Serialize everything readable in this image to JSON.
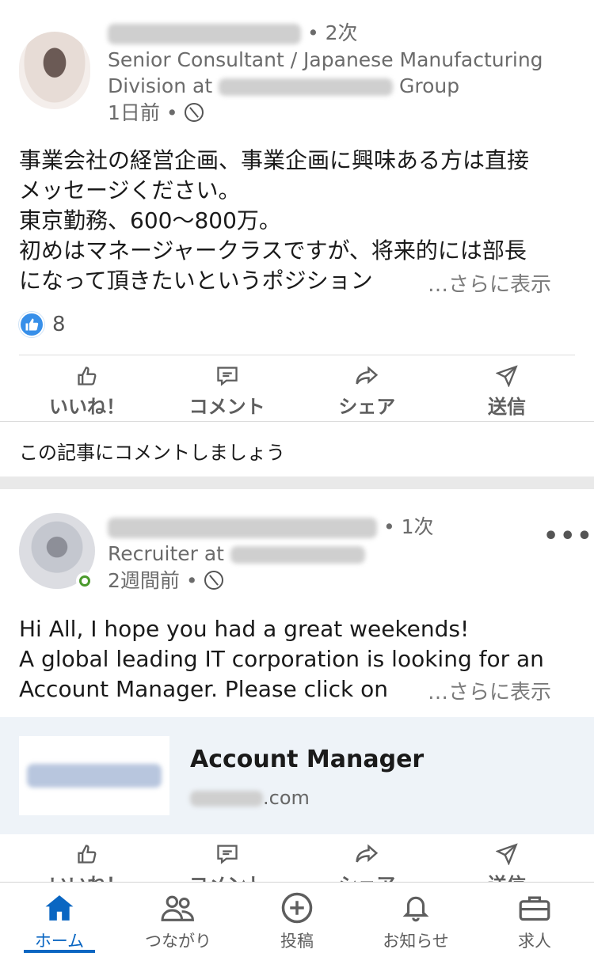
{
  "posts": [
    {
      "degree": "• 2次",
      "headline_line1": "Senior Consultant / Japanese Manufacturing",
      "headline_line2_prefix": "Division at",
      "headline_line2_suffix": "Group",
      "time": "1日前 •",
      "text_lines": [
        "事業会社の経営企画、事業企画に興味ある方は直接",
        "メッセージください。",
        "東京勤務、600〜800万。",
        "初めはマネージャークラスですが、将来的には部長",
        "になって頂きたいというポジション"
      ],
      "see_more": "…さらに表示",
      "reaction_count": "8",
      "comment_prompt": "この記事にコメントしましょう"
    },
    {
      "degree": "• 1次",
      "headline_prefix": "Recruiter at",
      "time": "2週間前 •",
      "text_lines": [
        "Hi All, I hope you had a great weekends!",
        "A global leading IT corporation is looking for an",
        "Account Manager. Please click on"
      ],
      "see_more": "…さらに表示",
      "link_title": "Account Manager",
      "link_domain_suffix": ".com"
    }
  ],
  "actions": {
    "like": "いいね！",
    "comment": "コメント",
    "share": "シェア",
    "send": "送信"
  },
  "nav": {
    "home": "ホーム",
    "network": "つながり",
    "post": "投稿",
    "notifications": "お知らせ",
    "jobs": "求人"
  },
  "icons": {
    "like": "thumbs-up-icon",
    "comment": "comment-icon",
    "share": "share-arrow-icon",
    "send": "send-icon",
    "home": "home-icon",
    "network": "people-icon",
    "post": "plus-circle-icon",
    "notifications": "bell-icon",
    "jobs": "briefcase-icon",
    "visibility": "globe-icon"
  },
  "colors": {
    "accent": "#0a66c2",
    "like_badge": "#378fe9",
    "online": "#4a9a2c",
    "link_card_bg": "#eef3f8"
  }
}
